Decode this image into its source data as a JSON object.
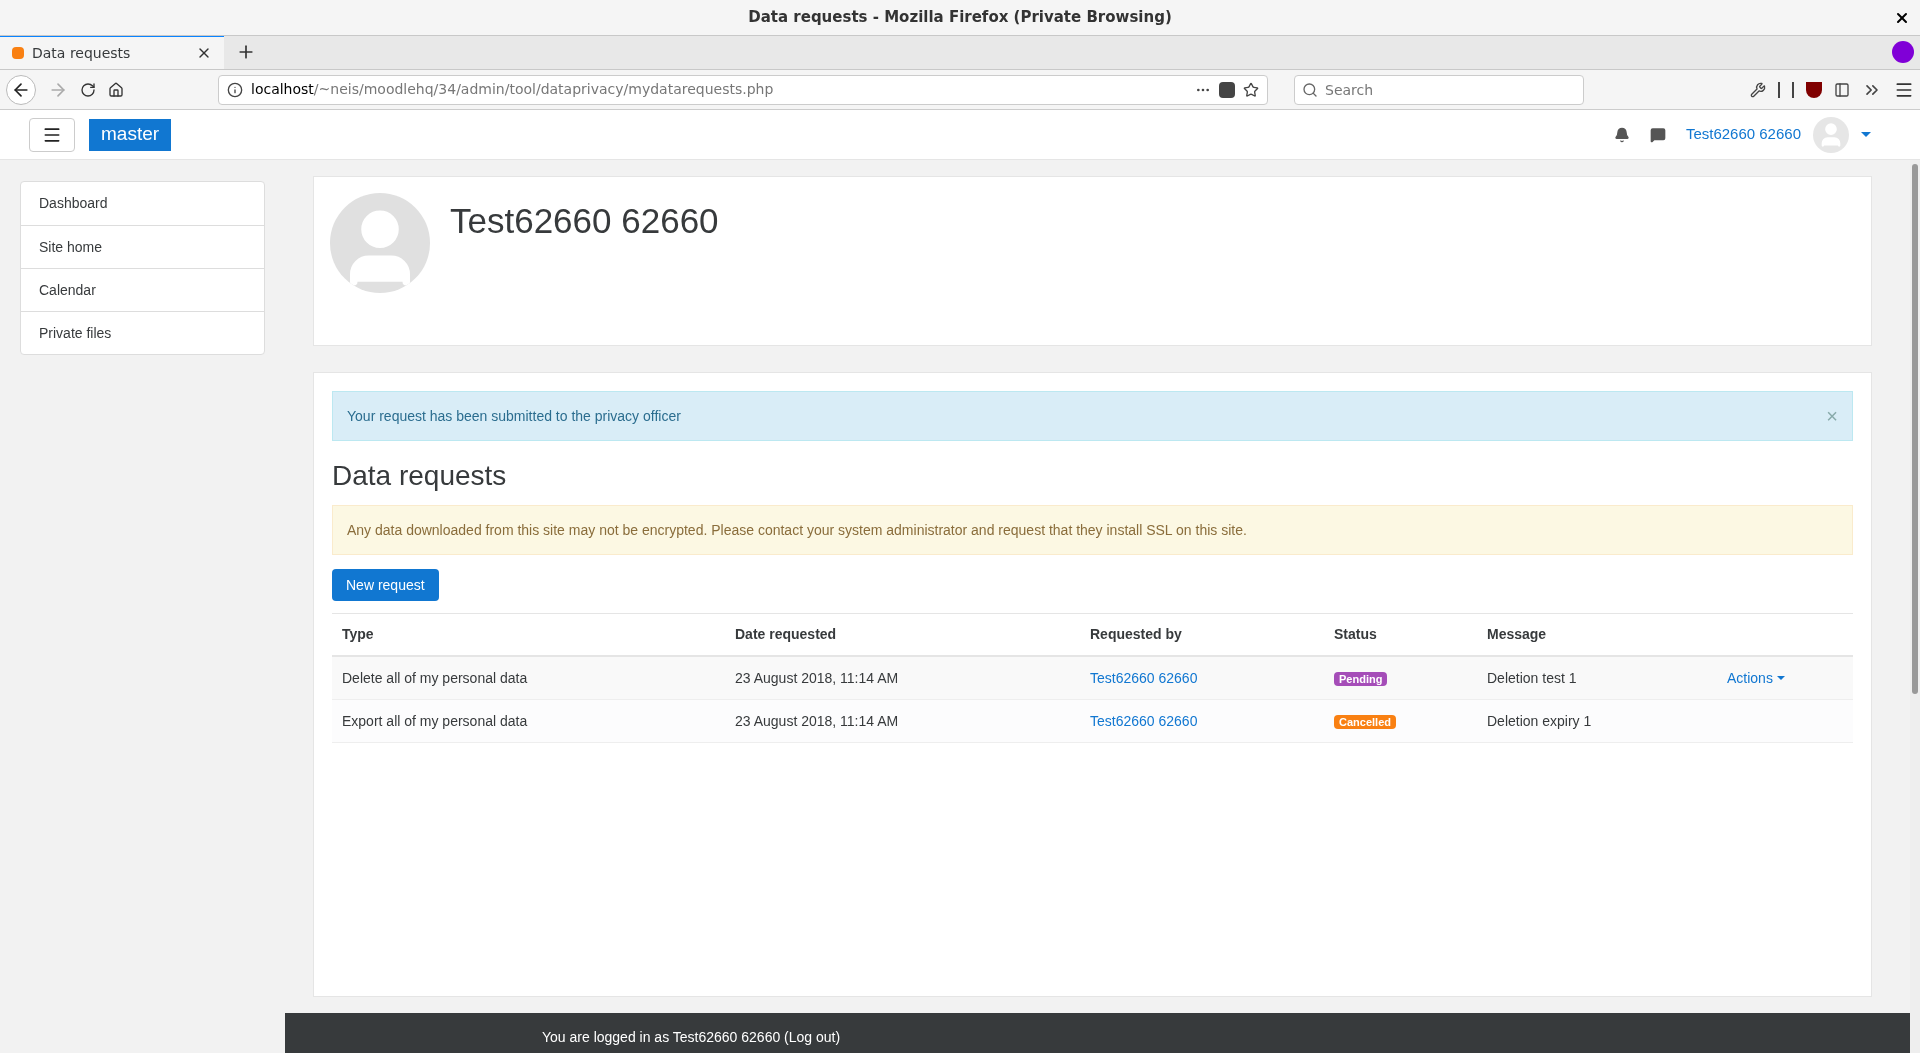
{
  "window": {
    "title": "Data requests - Mozilla Firefox (Private Browsing)"
  },
  "tabs": [
    {
      "label": "Data requests",
      "selected": true
    }
  ],
  "address_bar": {
    "host": "localhost",
    "path": "/~neis/moodlehq/34/admin/tool/dataprivacy/mydatarequests.php"
  },
  "search": {
    "placeholder": "Search"
  },
  "navbar": {
    "brand": "master",
    "user": "Test62660 62660"
  },
  "sidebar": {
    "items": [
      {
        "label": "Dashboard"
      },
      {
        "label": "Site home"
      },
      {
        "label": "Calendar"
      },
      {
        "label": "Private files"
      }
    ]
  },
  "profile": {
    "name": "Test62660 62660"
  },
  "alert": {
    "message": "Your request has been submitted to the privacy officer",
    "close": "×"
  },
  "heading": "Data requests",
  "warning": "Any data downloaded from this site may not be encrypted. Please contact your system administrator and request that they install SSL on this site.",
  "new_request_button": "New request",
  "table": {
    "columns": [
      "Type",
      "Date requested",
      "Requested by",
      "Status",
      "Message"
    ],
    "rows": [
      {
        "type": "Delete all of my personal data",
        "date": "23 August 2018, 11:14 AM",
        "requested_by": "Test62660 62660",
        "status": "Pending",
        "color": "#a54db8",
        "message": "Deletion test 1",
        "actions": "Actions"
      },
      {
        "type": "Export all of my personal data",
        "date": "23 August 2018, 11:14 AM",
        "requested_by": "Test62660 62660",
        "status": "Cancelled",
        "color": "#f98012",
        "message": "Deletion expiry 1"
      }
    ]
  },
  "footer": {
    "text": "You are logged in as Test62660 62660",
    "link": "(Log out)"
  }
}
